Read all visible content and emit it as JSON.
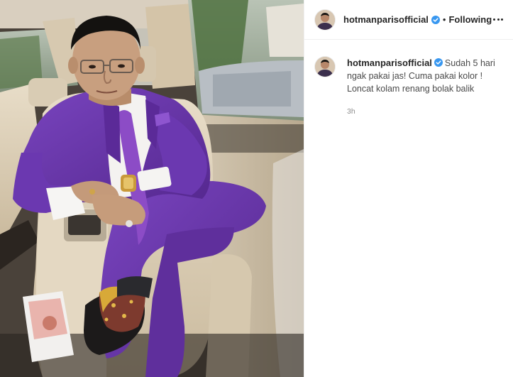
{
  "author": {
    "username": "hotmanparisofficial",
    "verified": true,
    "verified_icon": "verified-badge-icon",
    "follow_state": "Following",
    "separator": "•"
  },
  "post": {
    "caption": "Sudah 5 hari ngak pakai jas! Cuma pakai kolor ! Loncat kolam renang bolak balik",
    "time_ago": "3h"
  },
  "icons": {
    "more": "more-options-icon",
    "avatar": "profile-avatar"
  },
  "colors": {
    "verified_blue": "#3897f0",
    "secondary_text": "#8e8e8e",
    "suit_purple": "#6a3aa8"
  }
}
